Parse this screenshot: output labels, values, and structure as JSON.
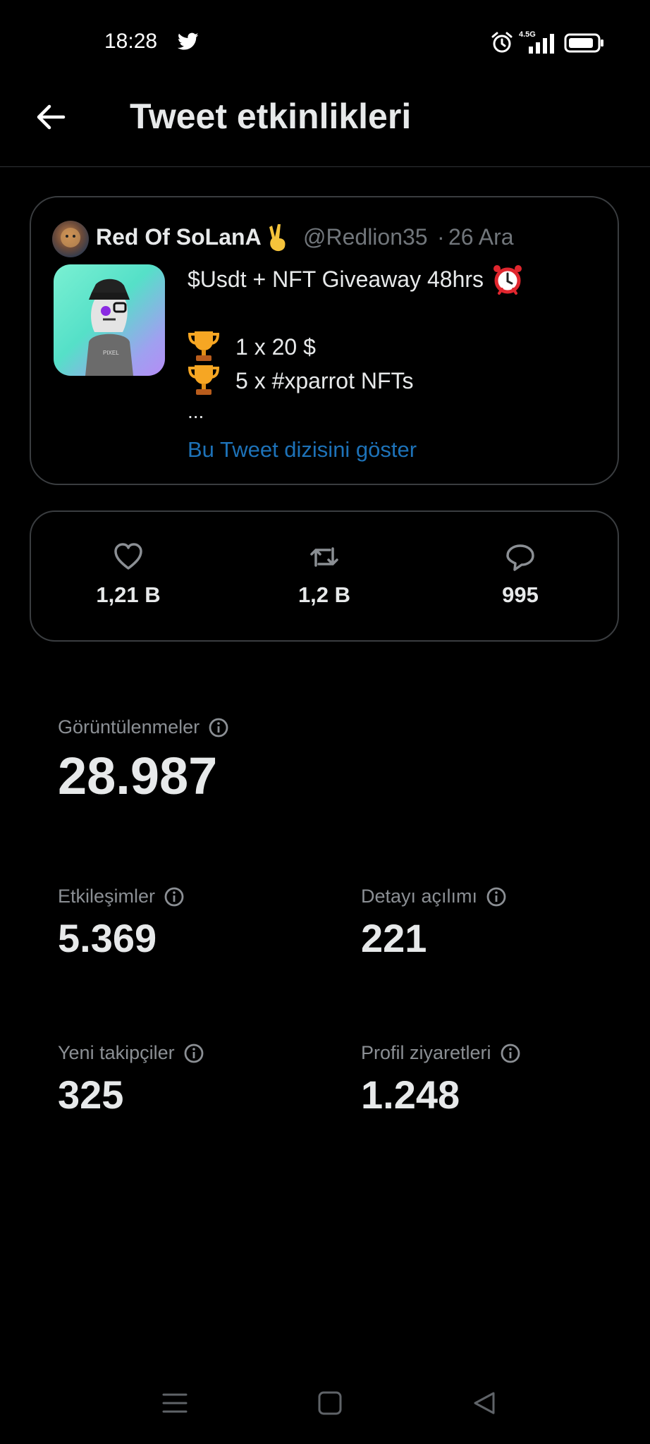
{
  "status_bar": {
    "time": "18:28",
    "network": "4.5G",
    "icons": [
      "twitter-icon",
      "alarm-icon",
      "signal-icon",
      "battery-icon"
    ]
  },
  "header": {
    "title": "Tweet etkinlikleri",
    "back_icon": "arrow-left-icon"
  },
  "tweet": {
    "author_name": "Red Of SoLanA",
    "author_emoji": "victory-hand",
    "handle": "@Redlion35",
    "separator": "·",
    "date": "26 Ara",
    "line1": "$Usdt + NFT Giveaway 48hrs",
    "line1_emoji": "alarm-clock",
    "line2": "1 x  20 $",
    "line3": "5 x  #xparrot NFTs",
    "ellipsis": "...",
    "show_thread": "Bu Tweet dizisini göster"
  },
  "engagement": {
    "likes": "1,21 B",
    "retweets": "1,2 B",
    "replies": "995"
  },
  "metrics": {
    "views": {
      "label": "Görüntülenmeler",
      "value": "28.987"
    },
    "engagements": {
      "label": "Etkileşimler",
      "value": "5.369"
    },
    "detail_expands": {
      "label": "Detayı açılımı",
      "value": "221"
    },
    "new_followers": {
      "label": "Yeni takipçiler",
      "value": "325"
    },
    "profile_visits": {
      "label": "Profil ziyaretleri",
      "value": "1.248"
    }
  },
  "nav_bar": [
    "menu-icon",
    "home-square-icon",
    "back-triangle-icon"
  ],
  "colors": {
    "background": "#000000",
    "text": "#e7e9ea",
    "muted": "#71767b",
    "link": "#1d72b8",
    "border": "#3a3d40"
  }
}
